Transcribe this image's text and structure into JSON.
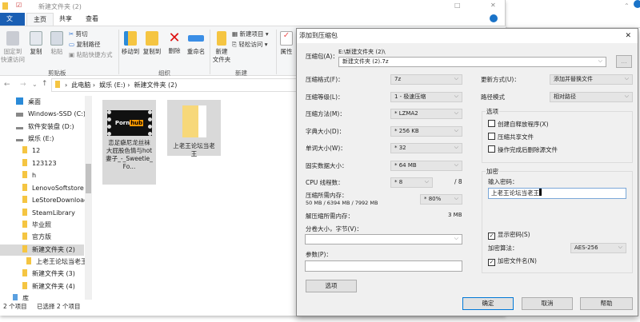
{
  "explorer": {
    "title": "新建文件夹 (2)",
    "tabs": [
      "文件",
      "主页",
      "共享",
      "查看"
    ],
    "ribbon": {
      "pin": "固定到\n快速访问",
      "copy": "复制",
      "paste": "粘贴",
      "cut": "剪切",
      "copy_path": "复制路径",
      "paste_shortcut": "粘贴快捷方式",
      "move_to": "移动到",
      "copy_to": "复制到",
      "delete": "删除",
      "rename": "重命名",
      "new_folder": "新建\n文件夹",
      "new_item": "新建项目",
      "easy_access": "轻松访问",
      "properties": "属性",
      "groups": [
        "剪贴板",
        "组织",
        "新建"
      ]
    },
    "breadcrumb": [
      "此电脑",
      "娱乐 (E:)",
      "新建文件夹 (2)"
    ],
    "nav": [
      "桌面",
      "Windows-SSD (C:)",
      "软件安装盘 (D:)",
      "娱乐 (E:)",
      "12",
      "123123",
      "h",
      "LenovoSoftstore",
      "LeStoreDownload",
      "SteamLibrary",
      "毕业照",
      "官方版",
      "新建文件夹 (2)",
      "上老王论坛当老王",
      "新建文件夹 (3)",
      "新建文件夹 (4)",
      "库"
    ],
    "files": [
      {
        "name": "恋足癖尼龙丝袜大屁股色情与hot妻子_-_Sweetie_Fo...",
        "thumb_text": "Porn",
        "thumb_badge": "hub"
      },
      {
        "name": "上老王论坛当老王"
      }
    ],
    "status": {
      "count": "2 个项目",
      "selected": "已选择 2 个项目"
    }
  },
  "dialog": {
    "title": "添加到压缩包",
    "archive_label": "压缩包(A)：",
    "archive_path": "E:\\新建文件夹 (2)\\",
    "archive_name": "新建文件夹 (2).7z",
    "browse": "...",
    "format_label": "压缩格式(F)：",
    "format": "7z",
    "level_label": "压缩等级(L)：",
    "level": "1 - 极速压缩",
    "method_label": "压缩方法(M)：",
    "method": "* LZMA2",
    "dict_label": "字典大小(D)：",
    "dict": "* 256 KB",
    "word_label": "单词大小(W)：",
    "word": "* 32",
    "solid_label": "固实数据大小：",
    "solid": "* 64 MB",
    "cpu_label": "CPU 线程数：",
    "cpu": "* 8",
    "cpu_max": "/ 8",
    "mem_label": "压缩所需内存：",
    "mem_value": "50 MB / 6394 MB / 7992 MB",
    "mem_pct": "* 80%",
    "decomp_label": "解压缩所需内存：",
    "decomp_value": "3 MB",
    "split_label": "分卷大小，字节(V)：",
    "split": "",
    "params_label": "参数(P)：",
    "params": "",
    "options_button": "选项",
    "update_label": "更新方式(U)：",
    "update": "添加并替换文件",
    "path_label": "路径模式",
    "path": "相对路径",
    "options_group": "选项",
    "opt_sfx": "创建自释放程序(X)",
    "opt_shared": "压缩共享文件",
    "opt_delete": "操作完成后删除源文件",
    "enc_group": "加密",
    "pwd_label": "输入密码：",
    "pwd": "上老王论坛当老王",
    "show_pwd": "显示密码(S)",
    "enc_method_label": "加密算法：",
    "enc_method": "AES-256",
    "enc_names": "加密文件名(N)",
    "ok": "确定",
    "cancel": "取消",
    "help": "帮助"
  }
}
